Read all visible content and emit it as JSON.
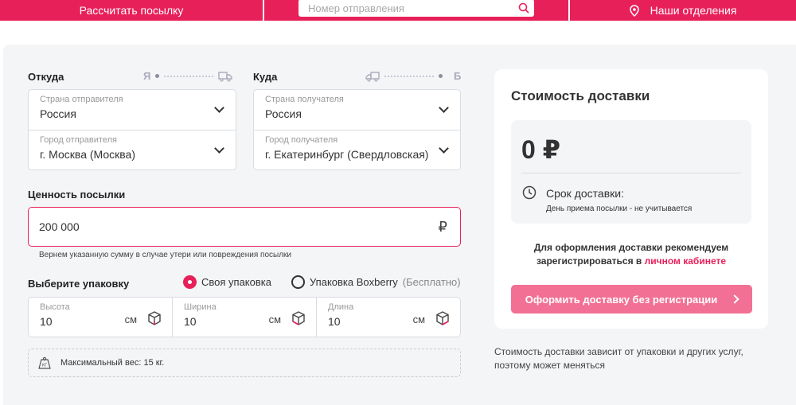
{
  "topbar": {
    "calc_label": "Рассчитать посылку",
    "search_placeholder": "Номер отправления",
    "offices_label": "Наши отделения"
  },
  "from": {
    "label": "Откуда",
    "route_letter": "Я",
    "country_label": "Страна отправителя",
    "country_value": "Россия",
    "city_label": "Город отправителя",
    "city_value": "г. Москва (Москва)"
  },
  "to": {
    "label": "Куда",
    "route_letter": "Б",
    "country_label": "Страна получателя",
    "country_value": "Россия",
    "city_label": "Город получателя",
    "city_value": "г. Екатеринбург (Свердловская)"
  },
  "parcel_value": {
    "label": "Ценность посылки",
    "value": "200 000",
    "currency": "₽",
    "note": "Вернем указанную сумму в случае утери или повреждения посылки"
  },
  "packaging": {
    "label": "Выберите упаковку",
    "option_own": "Своя упаковка",
    "option_boxberry": "Упаковка Boxberry",
    "option_boxberry_note": "(Бесплатно)",
    "selected": "own"
  },
  "dimensions": [
    {
      "label": "Высота",
      "value": "10",
      "unit": "см"
    },
    {
      "label": "Ширина",
      "value": "10",
      "unit": "см"
    },
    {
      "label": "Длина",
      "value": "10",
      "unit": "см"
    }
  ],
  "weight": {
    "icon_text": "КГ",
    "text": "Максимальный вес: 15 кг."
  },
  "cost_card": {
    "title": "Стоимость доставки",
    "price": "0 ₽",
    "term_label": "Срок доставки:",
    "term_note": "День приема посылки - не учитывается",
    "register_text": "Для оформления доставки рекомендуем зарегистрироваться в",
    "register_link": "личном кабинете",
    "button_label": "Оформить доставку без регистрации"
  },
  "footer_note": "Стоимость доставки зависит от упаковки и других услуг, поэтому может меняться",
  "colors": {
    "brand": "#e8205a",
    "button": "#f27094",
    "panel_bg": "#f4f5f7"
  }
}
